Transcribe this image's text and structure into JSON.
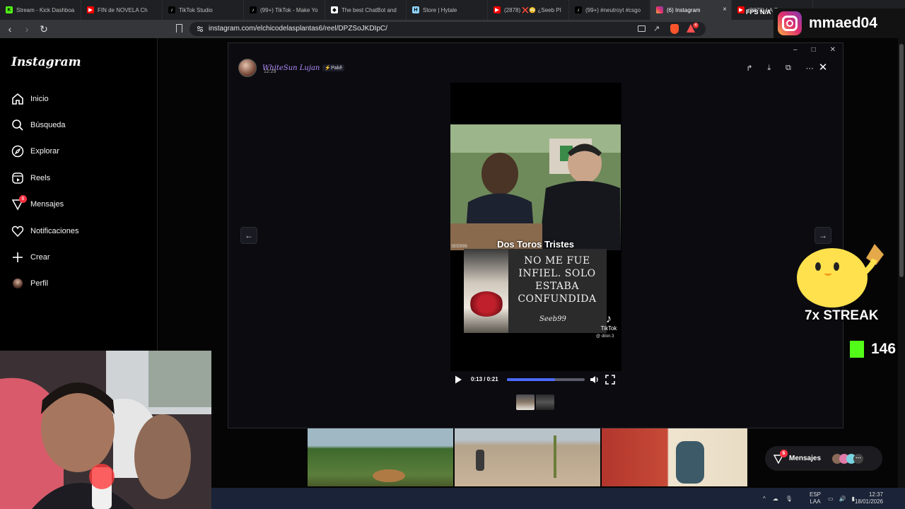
{
  "browser": {
    "tabs": [
      {
        "title": "Stream - Kick Dashboa",
        "icon": "kick-icon",
        "color": "#53fc18"
      },
      {
        "title": "FIN de NOVELA Ch",
        "icon": "youtube-icon",
        "color": "#ff0000"
      },
      {
        "title": "TikTok Studio",
        "icon": "tiktok-icon",
        "color": "#ffffff"
      },
      {
        "title": "(99+) TikTok - Make Yo",
        "icon": "tiktok-icon",
        "color": "#ffffff"
      },
      {
        "title": "The best ChatBot and",
        "icon": "chatbot-icon",
        "color": "#ffffff"
      },
      {
        "title": "Store | Hytale",
        "icon": "hytale-icon",
        "color": "#8fd3ff"
      },
      {
        "title": "(2878) ❌😳 ¿Seeb PI",
        "icon": "youtube-icon",
        "color": "#ff0000"
      },
      {
        "title": "(99+) #neutroyt #csgo",
        "icon": "tiktok-icon",
        "color": "#ffffff"
      },
      {
        "title": "(6) Instagram",
        "icon": "instagram-icon",
        "color": "#e1306c"
      },
      {
        "title": "(2878) LA R",
        "icon": "youtube-icon",
        "color": "#ff0000"
      }
    ],
    "active_tab_close": "×",
    "url": "instagram.com/elchicodelasplantas6/reel/DPZSoJKDIpC/",
    "extension_badge": "4"
  },
  "instagram": {
    "logo": "Instagram",
    "nav": [
      {
        "label": "Inicio",
        "icon": "home-icon"
      },
      {
        "label": "Búsqueda",
        "icon": "search-icon"
      },
      {
        "label": "Explorar",
        "icon": "compass-icon"
      },
      {
        "label": "Reels",
        "icon": "reels-icon"
      },
      {
        "label": "Mensajes",
        "icon": "messenger-icon",
        "badge": "6"
      },
      {
        "label": "Notificaciones",
        "icon": "heart-icon"
      },
      {
        "label": "Crear",
        "icon": "plus-icon"
      },
      {
        "label": "Perfil",
        "icon": "avatar-icon"
      }
    ]
  },
  "post": {
    "username": "WhiteSun Lujan",
    "tag": "⚡Pakê",
    "time": "12:29",
    "caption_top": "Dos Toros Tristes",
    "watermark": "SEEB99",
    "meme_text": "NO ME FUE INFIEL. SOLO ESTABA CONFUNDIDA",
    "meme_logo": "Seeb99",
    "tiktok_label": "TikTok",
    "tiktok_user": "@ dilon.3",
    "player": {
      "time": "0:13 / 0:21",
      "progress": 0.62
    }
  },
  "overlay": {
    "fps": "FPS N/A",
    "brand": "mmaed04",
    "streak": "7x STREAK",
    "kick_count": "146"
  },
  "messages_pill": {
    "label": "Mensajes",
    "badge": "6"
  },
  "taskbar": {
    "lang1": "ESP",
    "lang2": "LAA",
    "time": "12:37",
    "date": "18/01/2026"
  }
}
